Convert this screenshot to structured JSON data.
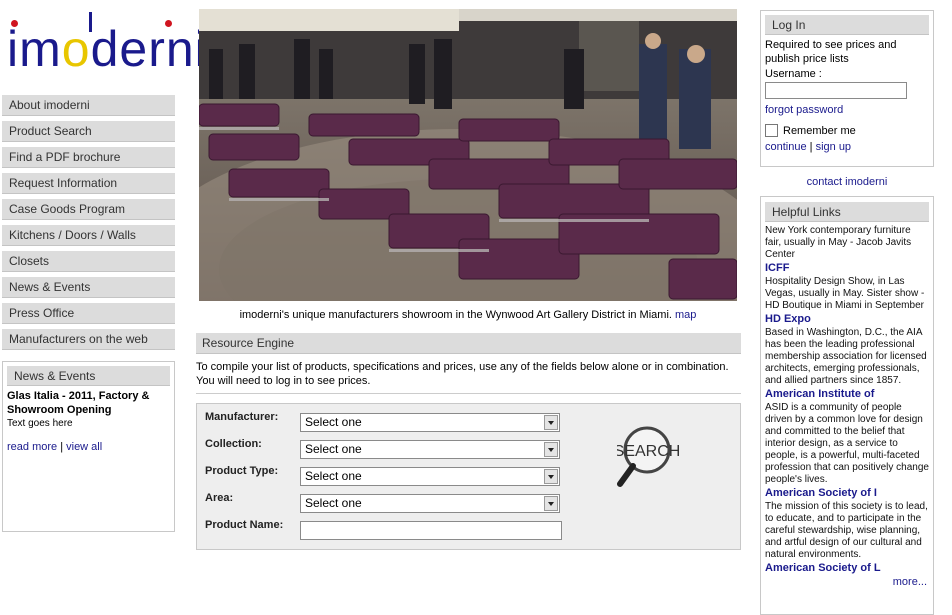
{
  "logo": {
    "text_pre": "im",
    "text_o": "o",
    "text_post": "derni"
  },
  "nav": {
    "items": [
      "About imoderni",
      "Product Search",
      "Find a PDF brochure",
      "Request Information",
      "Case Goods Program",
      "Kitchens / Doors / Walls",
      "Closets",
      "News & Events",
      "Press Office",
      "Manufacturers on the web"
    ]
  },
  "news": {
    "header": "News & Events",
    "title": "Glas Italia - 2011, Factory & Showroom Opening",
    "text": "Text goes here",
    "read_more": "read more",
    "separator": "|",
    "view_all": "view all"
  },
  "hero": {
    "caption": "imoderni's unique manufacturers showroom in the Wynwood Art Gallery District in Miami.",
    "map_link": "map"
  },
  "resource": {
    "header": "Resource Engine",
    "desc_line1": "To compile your list of products, specifications and prices, use any of the fields below alone or in combination.",
    "desc_line2": "You will need to log in to see prices.",
    "fields": {
      "manufacturer": {
        "label": "Manufacturer:",
        "value": "Select one"
      },
      "collection": {
        "label": "Collection:",
        "value": "Select one"
      },
      "product_type": {
        "label": "Product Type:",
        "value": "Select one"
      },
      "area": {
        "label": "Area:",
        "value": "Select one"
      },
      "product_name": {
        "label": "Product Name:",
        "value": ""
      }
    },
    "search_text": "SEARCH"
  },
  "login": {
    "header": "Log In",
    "required": "Required to see prices and publish price lists",
    "username_label": "Username :",
    "forgot": "forgot password",
    "remember": "Remember me",
    "continue": "continue",
    "separator": "|",
    "signup": "sign up"
  },
  "contact": "contact imoderni",
  "helpful": {
    "header": "Helpful Links",
    "items": [
      {
        "text": "New York contemporary furniture fair, usually in May - Jacob Javits Center",
        "title": "ICFF"
      },
      {
        "text": "Hospitality Design Show, in Las Vegas, usually in May. Sister show - HD Boutique in Miami in September",
        "title": "HD Expo"
      },
      {
        "text": "Based in Washington, D.C., the AIA has been the leading professional membership association for licensed architects, emerging professionals, and allied partners since 1857.",
        "title": "American Institute of"
      },
      {
        "text": "ASID is a community of people driven by a common love for design and committed to the belief that interior design, as a service to people, is a powerful, multi-faceted profession that can positively change people's lives.",
        "title": "American Society of I"
      },
      {
        "text": "The mission of this society is to lead, to educate, and to participate in the careful stewardship, wise planning, and artful design of our cultural and natural environments.",
        "title": "American Society of L"
      }
    ],
    "more": "more..."
  },
  "colors": {
    "brand_blue": "#1a1a8c",
    "brand_red": "#d0141f",
    "brand_yellow": "#e8c600",
    "header_gray": "#dcdcdc"
  }
}
